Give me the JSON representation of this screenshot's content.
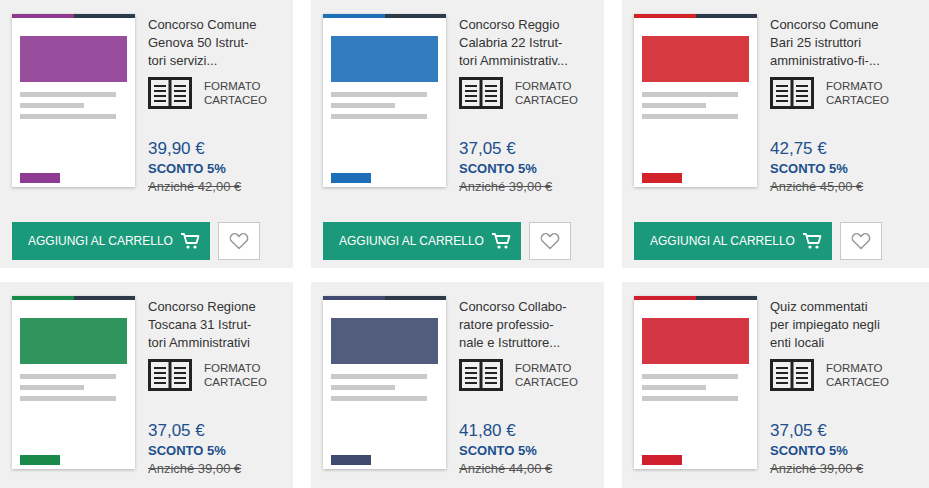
{
  "products": [
    {
      "title_lines": [
        "Concorso Comune",
        "Genova 50 Istrut-",
        "tori servizi..."
      ],
      "format_lines": [
        "FORMATO",
        "CARTACEO"
      ],
      "price": "39,90 €",
      "discount": "SCONTO 5%",
      "old_price": "Anziché 42,00 €",
      "cover_color": "#8e3b92",
      "button": "AGGIUNGI AL CARRELLO",
      "favorite": false
    },
    {
      "title_lines": [
        "Concorso Reggio",
        "Calabria 22 Istrut-",
        "tori Amministrativ..."
      ],
      "format_lines": [
        "FORMATO",
        "CARTACEO"
      ],
      "price": "37,05 €",
      "discount": "SCONTO 5%",
      "old_price": "Anziché 39,00 €",
      "cover_color": "#1d6fb8",
      "button": "AGGIUNGI AL CARRELLO",
      "favorite": false
    },
    {
      "title_lines": [
        "Concorso Comune",
        "Bari 25 istruttori",
        "amministrativo-fi-..."
      ],
      "format_lines": [
        "FORMATO",
        "CARTACEO"
      ],
      "price": "42,75 €",
      "discount": "SCONTO 5%",
      "old_price": "Anziché 45,00 €",
      "cover_color": "#d2232a",
      "button": "AGGIUNGI AL CARRELLO",
      "favorite": false
    },
    {
      "title_lines": [
        "Concorso Regione",
        "Toscana 31 Istrut-",
        "tori Amministrativi"
      ],
      "format_lines": [
        "FORMATO",
        "CARTACEO"
      ],
      "price": "37,05 €",
      "discount": "SCONTO 5%",
      "old_price": "Anziché 39,00 €",
      "cover_color": "#1a8a4a"
    },
    {
      "title_lines": [
        "Concorso Collabo-",
        "ratore professio-",
        "nale e Istruttore..."
      ],
      "format_lines": [
        "FORMATO",
        "CARTACEO"
      ],
      "price": "41,80 €",
      "discount": "SCONTO 5%",
      "old_price": "Anziché 44,00 €",
      "cover_color": "#3f4a6e"
    },
    {
      "title_lines": [
        "Quiz commentati",
        "per impiegato negli",
        "enti locali"
      ],
      "format_lines": [
        "FORMATO",
        "CARTACEO"
      ],
      "price": "37,05 €",
      "discount": "SCONTO 5%",
      "old_price": "Anziché 39,00 €",
      "cover_color": "#d0202f"
    }
  ]
}
